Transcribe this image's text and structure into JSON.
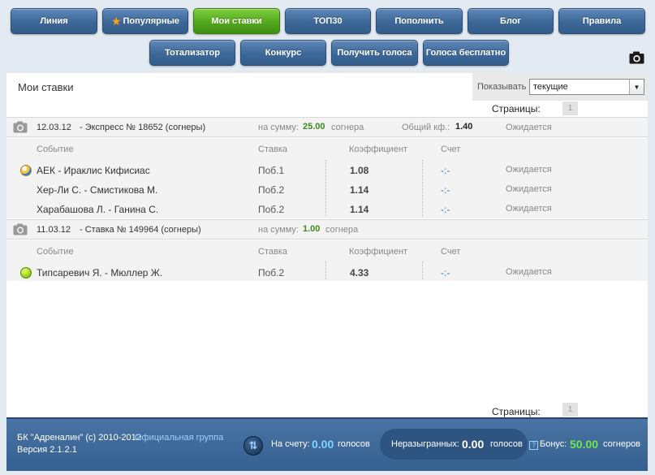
{
  "nav": {
    "row1": [
      "Линия",
      "Популярные",
      "Мои ставки",
      "ТОП30",
      "Пополнить",
      "Блог",
      "Правила"
    ],
    "row2": [
      "Тотализатор",
      "Конкурс",
      "Получить голоса",
      "Голоса бесплатно"
    ]
  },
  "panel": {
    "title": "Мои ставки",
    "filter_label": "Показывать",
    "filter_value": "текущие",
    "pages_label": "Страницы:",
    "current_page": "1"
  },
  "columns": {
    "event": "Событие",
    "stake": "Ставка",
    "coef": "Коэффициент",
    "score": "Счет"
  },
  "bets": [
    {
      "date": "12.03.12",
      "title": "- Экспресс № 18652 (согнеры)",
      "sum_label": "на сумму:",
      "sum_value": "25.00",
      "sum_unit": "согнера",
      "total_label": "Общий кф.:",
      "total_value": "1.40",
      "status": "Ожидается",
      "events": [
        {
          "sport_icon": "volleyball-icon",
          "event": "АЕК - Ираклис Кифисиас",
          "stake": "Поб.1",
          "coef": "1.08",
          "score": "-:-",
          "status": "Ожидается"
        },
        {
          "sport_icon": "",
          "event": "Хер-Ли С. - Смистикова М.",
          "stake": "Поб.2",
          "coef": "1.14",
          "score": "-:-",
          "status": "Ожидается"
        },
        {
          "sport_icon": "",
          "event": "Харабашова Л. - Ганина С.",
          "stake": "Поб.2",
          "coef": "1.14",
          "score": "-:-",
          "status": "Ожидается"
        }
      ]
    },
    {
      "date": "11.03.12",
      "title": "- Ставка № 149964 (согнеры)",
      "sum_label": "на сумму:",
      "sum_value": "1.00",
      "sum_unit": "согнера",
      "events": [
        {
          "sport_icon": "tennis-ball-icon",
          "event": "Типсаревич Я. - Мюллер Ж.",
          "stake": "Поб.2",
          "coef": "4.33",
          "score": "-:-",
          "status": "Ожидается"
        }
      ]
    }
  ],
  "footer": {
    "copyright": "БК \"Адреналин\" (c) 2010-2012",
    "group_link": "Официальная группа",
    "version": "Версия 2.1.2.1",
    "balance_label": "На счету:",
    "balance_value": "0.00",
    "balance_unit": "голосов",
    "unplayed_label": "Неразыгранных:",
    "unplayed_value": "0.00",
    "unplayed_unit": "голосов",
    "bonus_label": "Бонус:",
    "bonus_value": "50.00",
    "bonus_unit": "согнеров"
  },
  "colors": {
    "nav_blue": "#3c6797",
    "nav_active_green": "#53a81e",
    "footer_blue": "#355f8f",
    "amount_green": "#3c8a17"
  }
}
